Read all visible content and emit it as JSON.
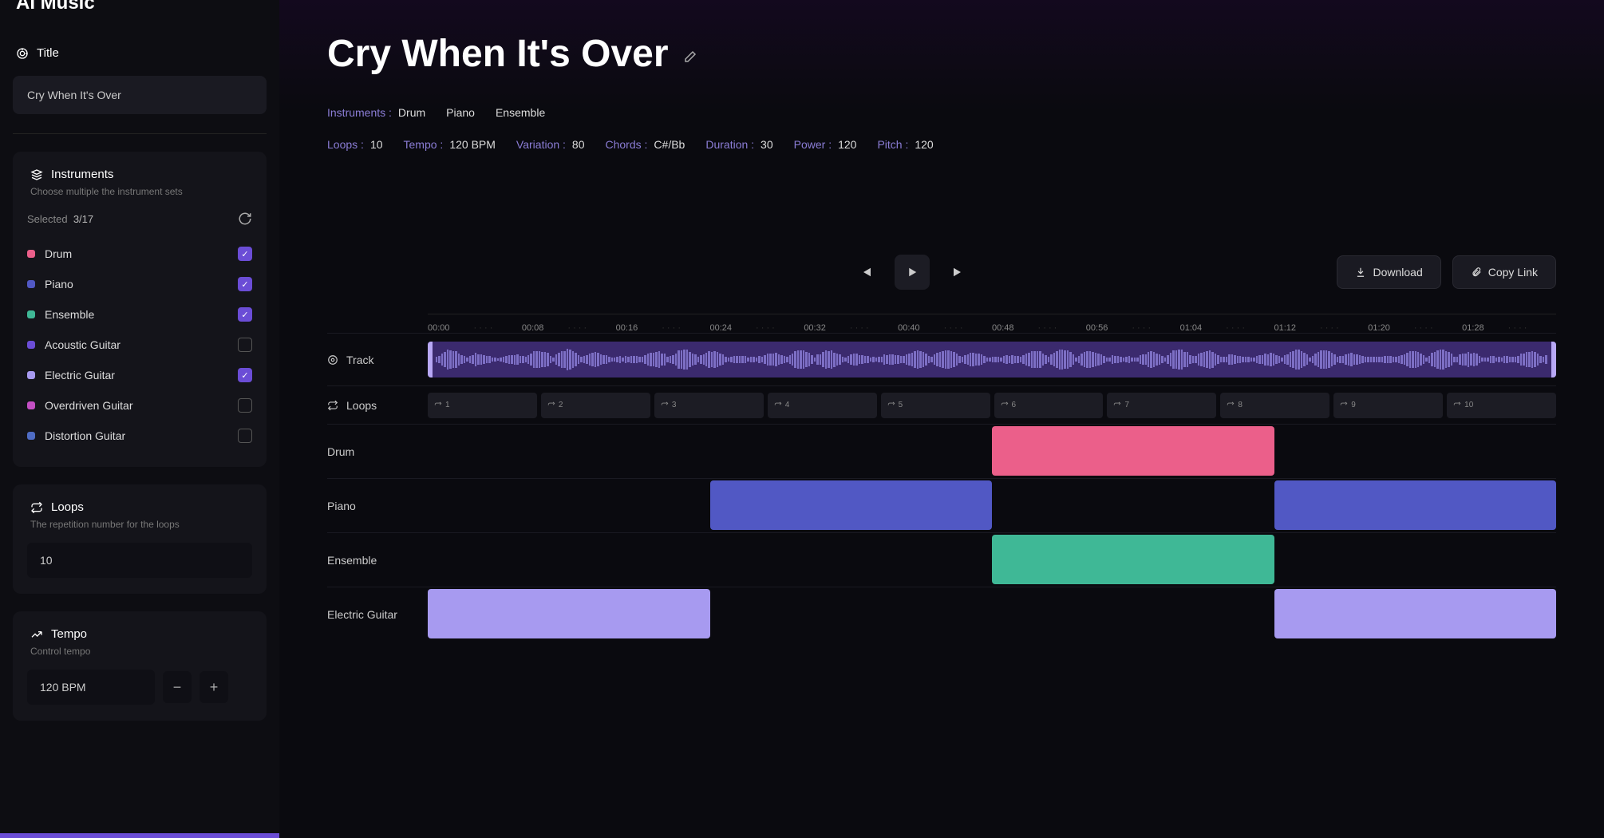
{
  "app_name": "AI Music",
  "sidebar": {
    "title_label": "Title",
    "title_value": "Cry When It's Over",
    "instruments_label": "Instruments",
    "instruments_sub": "Choose multiple the instrument sets",
    "selected_label": "Selected",
    "selected_count": "3/17",
    "instruments": [
      {
        "name": "Drum",
        "color": "#eb5f8a",
        "checked": true
      },
      {
        "name": "Piano",
        "color": "#5158c4",
        "checked": true
      },
      {
        "name": "Ensemble",
        "color": "#3fb896",
        "checked": true
      },
      {
        "name": "Acoustic Guitar",
        "color": "#6b4dd6",
        "checked": false
      },
      {
        "name": "Electric Guitar",
        "color": "#a79af0",
        "checked": true
      },
      {
        "name": "Overdriven Guitar",
        "color": "#c44fc4",
        "checked": false
      },
      {
        "name": "Distortion Guitar",
        "color": "#4f6cc4",
        "checked": false
      }
    ],
    "loops_label": "Loops",
    "loops_sub": "The repetition number for the loops",
    "loops_value": "10",
    "tempo_label": "Tempo",
    "tempo_sub": "Control tempo",
    "tempo_value": "120 BPM"
  },
  "main": {
    "title": "Cry When It's Over",
    "meta1": [
      {
        "lbl": "Instruments :",
        "val": "Drum"
      },
      {
        "lbl": "",
        "val": "Piano"
      },
      {
        "lbl": "",
        "val": "Ensemble"
      }
    ],
    "meta2": [
      {
        "lbl": "Loops :",
        "val": "10"
      },
      {
        "lbl": "Tempo :",
        "val": "120 BPM"
      },
      {
        "lbl": "Variation :",
        "val": "80"
      },
      {
        "lbl": "Chords :",
        "val": "C#/Bb"
      },
      {
        "lbl": "Duration :",
        "val": "30"
      },
      {
        "lbl": "Power :",
        "val": "120"
      },
      {
        "lbl": "Pitch :",
        "val": "120"
      }
    ],
    "download": "Download",
    "copy_link": "Copy Link",
    "ruler": [
      "00:00",
      "00:08",
      "00:16",
      "00:24",
      "00:32",
      "00:40",
      "00:48",
      "00:56",
      "01:04",
      "01:12",
      "01:20",
      "01:28"
    ],
    "track_label": "Track",
    "loops_row_label": "Loops",
    "loop_segments": [
      "1",
      "2",
      "3",
      "4",
      "5",
      "6",
      "7",
      "8",
      "9",
      "10"
    ],
    "clip_rows": [
      {
        "name": "Drum",
        "color": "#eb5f8a",
        "clips": [
          {
            "start": 5,
            "span": 2.5
          }
        ]
      },
      {
        "name": "Piano",
        "color": "#5158c4",
        "clips": [
          {
            "start": 2.5,
            "span": 2.5
          },
          {
            "start": 7.5,
            "span": 2.5
          }
        ]
      },
      {
        "name": "Ensemble",
        "color": "#3fb896",
        "clips": [
          {
            "start": 5,
            "span": 2.5
          }
        ]
      },
      {
        "name": "Electric Guitar",
        "color": "#a79af0",
        "clips": [
          {
            "start": 0,
            "span": 2.5
          },
          {
            "start": 7.5,
            "span": 2.5
          }
        ]
      }
    ]
  }
}
